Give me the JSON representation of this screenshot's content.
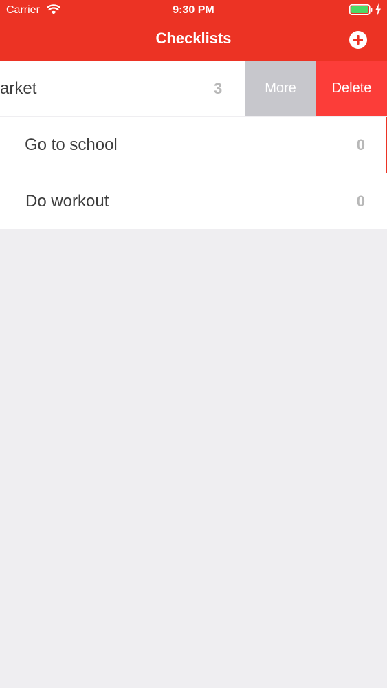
{
  "status_bar": {
    "carrier": "Carrier",
    "time": "9:30 PM",
    "battery_color": "#4cd964"
  },
  "nav": {
    "title": "Checklists",
    "add_icon": "plus-circle-icon",
    "background_color": "#ec3324"
  },
  "checklists": [
    {
      "label": "arket",
      "count": "3"
    },
    {
      "label": "Go to school",
      "count": "0"
    },
    {
      "label": "Do workout",
      "count": "0"
    }
  ],
  "swipe_actions": {
    "more_label": "More",
    "delete_label": "Delete",
    "more_color": "#c7c7cc",
    "delete_color": "#fc3d39"
  }
}
